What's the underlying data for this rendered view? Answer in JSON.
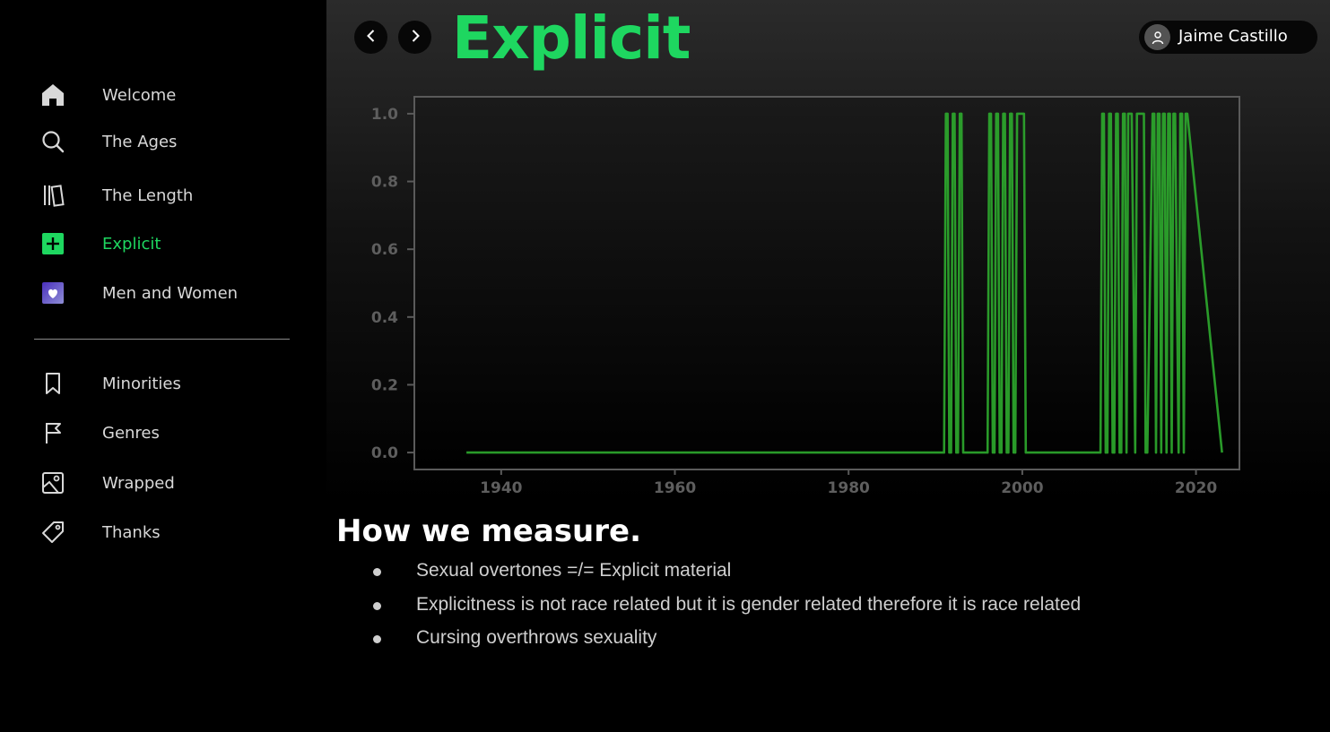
{
  "sidebar": {
    "items": [
      {
        "label": "Welcome",
        "icon": "home-icon"
      },
      {
        "label": "The Ages",
        "icon": "search-icon"
      },
      {
        "label": "The Length",
        "icon": "library-icon"
      },
      {
        "label": "Explicit",
        "icon": "plus-square-icon",
        "active": true
      },
      {
        "label": "Men and Women",
        "icon": "heart-square-icon"
      },
      {
        "label": "Minorities",
        "icon": "bookmark-icon"
      },
      {
        "label": "Genres",
        "icon": "flag-icon"
      },
      {
        "label": "Wrapped",
        "icon": "image-icon"
      },
      {
        "label": "Thanks",
        "icon": "tag-icon"
      }
    ]
  },
  "header": {
    "title": "Explicit",
    "user_name": "Jaime Castillo"
  },
  "colors": {
    "accent": "#1ed760",
    "line": "#2eab2e",
    "liked_songs_purple": "#5b4bc4"
  },
  "chart_data": {
    "type": "line",
    "title": "",
    "xlabel": "",
    "ylabel": "",
    "xlim": [
      1930,
      2025
    ],
    "ylim": [
      -0.05,
      1.05
    ],
    "xticks": [
      "1940",
      "1960",
      "1980",
      "2000",
      "2020"
    ],
    "yticks": [
      "0.0",
      "0.2",
      "0.4",
      "0.6",
      "0.8",
      "1.0"
    ],
    "grid": false,
    "series": [
      {
        "values_x": [
          1936,
          1991,
          1991.2,
          1991.4,
          1991.6,
          1991.8,
          1992.0,
          1992.2,
          1992.4,
          1992.6,
          1992.8,
          1993.0,
          1993.2,
          1993.4,
          1993.6,
          1996,
          1996.2,
          1996.4,
          1996.6,
          1996.8,
          1997.0,
          1997.2,
          1997.4,
          1997.6,
          1997.8,
          1998.0,
          1998.2,
          1998.4,
          1998.6,
          1998.8,
          1999.0,
          1999.2,
          1999.4,
          2000.2,
          2000.4,
          2009,
          2009.2,
          2009.4,
          2009.6,
          2009.8,
          2010.0,
          2010.2,
          2010.4,
          2010.6,
          2010.8,
          2011.0,
          2011.2,
          2011.4,
          2011.6,
          2011.8,
          2012.0,
          2012.2,
          2012.4,
          2012.6,
          2013.0,
          2013.2,
          2013.4,
          2013.6,
          2014.0,
          2014.2,
          2014.4,
          2015.0,
          2015.2,
          2015.4,
          2015.6,
          2015.8,
          2016.0,
          2016.2,
          2016.4,
          2016.6,
          2016.8,
          2017.0,
          2017.2,
          2017.4,
          2017.6,
          2018.0,
          2018.2,
          2018.4,
          2018.6,
          2018.8,
          2019.0,
          2023
        ],
        "values_y": [
          0,
          0,
          1,
          1,
          0,
          0,
          1,
          1,
          0,
          0,
          1,
          1,
          0,
          0,
          0,
          0,
          1,
          1,
          0,
          0,
          1,
          1,
          0,
          0,
          1,
          1,
          0,
          0,
          1,
          1,
          0,
          0,
          1,
          1,
          0,
          0,
          1,
          1,
          0,
          0,
          1,
          1,
          0,
          0,
          1,
          1,
          0,
          0,
          1,
          1,
          0,
          1,
          1,
          1,
          0,
          1,
          1,
          1,
          1,
          0,
          0,
          1,
          1,
          0,
          1,
          1,
          0,
          1,
          1,
          0,
          1,
          1,
          0,
          1,
          1,
          0,
          1,
          1,
          0,
          1,
          1,
          0
        ]
      }
    ]
  },
  "content": {
    "heading": "How we measure.",
    "bullets": [
      "Sexual overtones =/= Explicit material",
      "Explicitness is not race related but it is gender related therefore it is race related",
      "Cursing overthrows sexuality"
    ]
  }
}
